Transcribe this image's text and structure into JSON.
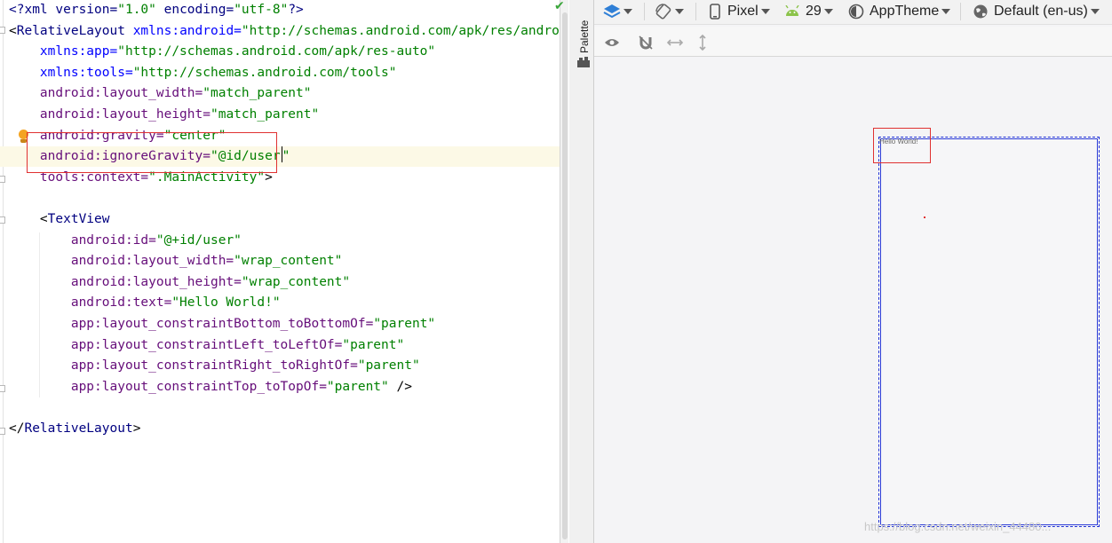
{
  "editor": {
    "lines": [
      {
        "parts": [
          {
            "t": "<?",
            "c": "pi"
          },
          {
            "t": "xml version=",
            "c": "pi"
          },
          {
            "t": "\"1.0\"",
            "c": "val"
          },
          {
            "t": " encoding=",
            "c": "pi"
          },
          {
            "t": "\"utf-8\"",
            "c": "val"
          },
          {
            "t": "?>",
            "c": "pi"
          }
        ]
      },
      {
        "parts": [
          {
            "t": "<",
            "c": "bracket"
          },
          {
            "t": "RelativeLayout ",
            "c": "tag"
          },
          {
            "t": "xmlns:android=",
            "c": "attr-ns"
          },
          {
            "t": "\"http://schemas.android.com/apk/res/android\"",
            "c": "val"
          }
        ]
      },
      {
        "parts": [
          {
            "t": "    xmlns:app=",
            "c": "attr-ns"
          },
          {
            "t": "\"http://schemas.android.com/apk/res-auto\"",
            "c": "val"
          }
        ]
      },
      {
        "parts": [
          {
            "t": "    xmlns:tools=",
            "c": "attr-ns"
          },
          {
            "t": "\"http://schemas.android.com/tools\"",
            "c": "val"
          }
        ]
      },
      {
        "parts": [
          {
            "t": "    android:layout_width=",
            "c": "attr"
          },
          {
            "t": "\"match_parent\"",
            "c": "val"
          }
        ]
      },
      {
        "parts": [
          {
            "t": "    android:layout_height=",
            "c": "attr"
          },
          {
            "t": "\"match_parent\"",
            "c": "val"
          }
        ]
      },
      {
        "parts": [
          {
            "t": "    android:gravity=",
            "c": "attr"
          },
          {
            "t": "\"center\"",
            "c": "val"
          }
        ]
      },
      {
        "parts": [
          {
            "t": "    android:ignoreGravity=",
            "c": "attr"
          },
          {
            "t": "\"@id/user",
            "c": "val"
          },
          {
            "t": "",
            "c": "caret"
          },
          {
            "t": "\"",
            "c": "val"
          }
        ],
        "caret_line": true
      },
      {
        "parts": [
          {
            "t": "    tools:context=",
            "c": "attr"
          },
          {
            "t": "\".MainActivity\"",
            "c": "val"
          },
          {
            "t": ">",
            "c": "bracket"
          }
        ]
      },
      {
        "parts": []
      },
      {
        "parts": [
          {
            "t": "    <",
            "c": "bracket"
          },
          {
            "t": "TextView",
            "c": "tag"
          }
        ]
      },
      {
        "parts": [
          {
            "t": "        android:id=",
            "c": "attr"
          },
          {
            "t": "\"@+id/user\"",
            "c": "val"
          }
        ]
      },
      {
        "parts": [
          {
            "t": "        android:layout_width=",
            "c": "attr"
          },
          {
            "t": "\"wrap_content\"",
            "c": "val"
          }
        ]
      },
      {
        "parts": [
          {
            "t": "        android:layout_height=",
            "c": "attr"
          },
          {
            "t": "\"wrap_content\"",
            "c": "val"
          }
        ]
      },
      {
        "parts": [
          {
            "t": "        android:text=",
            "c": "attr"
          },
          {
            "t": "\"Hello World!\"",
            "c": "val"
          }
        ]
      },
      {
        "parts": [
          {
            "t": "        app:layout_constraintBottom_toBottomOf=",
            "c": "attr"
          },
          {
            "t": "\"parent\"",
            "c": "val"
          }
        ]
      },
      {
        "parts": [
          {
            "t": "        app:layout_constraintLeft_toLeftOf=",
            "c": "attr"
          },
          {
            "t": "\"parent\"",
            "c": "val"
          }
        ]
      },
      {
        "parts": [
          {
            "t": "        app:layout_constraintRight_toRightOf=",
            "c": "attr"
          },
          {
            "t": "\"parent\"",
            "c": "val"
          }
        ]
      },
      {
        "parts": [
          {
            "t": "        app:layout_constraintTop_toTopOf=",
            "c": "attr"
          },
          {
            "t": "\"parent\"",
            "c": "val"
          },
          {
            "t": " />",
            "c": "bracket"
          }
        ]
      },
      {
        "parts": []
      },
      {
        "parts": [
          {
            "t": "</",
            "c": "bracket"
          },
          {
            "t": "RelativeLayout",
            "c": "tag"
          },
          {
            "t": ">",
            "c": "bracket"
          }
        ]
      }
    ]
  },
  "palette": {
    "label": "Palette"
  },
  "toolbar": {
    "device": "Pixel",
    "api": "29",
    "theme": "AppTheme",
    "locale": "Default (en-us)"
  },
  "preview": {
    "text": "Hello World!"
  },
  "watermark": "https://blog.csdn.net/weixin_44480..."
}
